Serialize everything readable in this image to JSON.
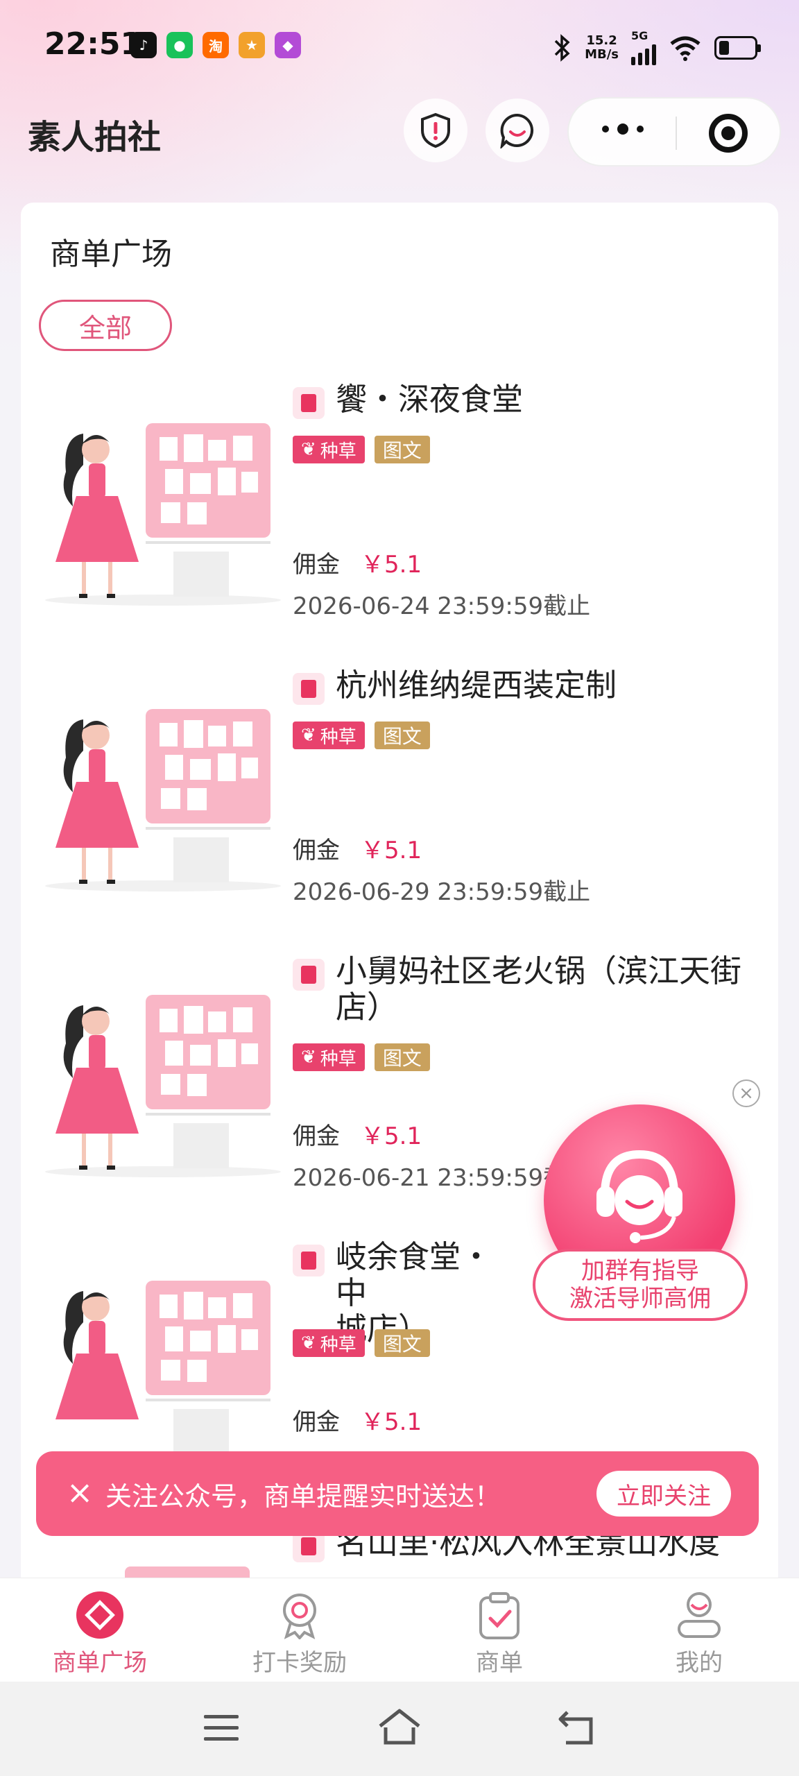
{
  "status_bar": {
    "time": "22:51",
    "speed_value": "15.2",
    "speed_unit": "MB/s",
    "network": "5G",
    "app_icons": [
      "tiktok-icon",
      "wechat-icon",
      "taobao-icon",
      "game-icon",
      "chat-app-icon"
    ]
  },
  "header": {
    "title": "素人拍社",
    "buttons": [
      "shield-alert-icon",
      "chat-bubble-icon",
      "more-dots-icon",
      "record-target-icon"
    ]
  },
  "main": {
    "section_title": "商单广场",
    "filter_chip": "全部",
    "commission_label": "佣金",
    "items": [
      {
        "title": "饗・深夜食堂",
        "tags": [
          "种草",
          "图文"
        ],
        "price": "￥5.1",
        "deadline": "2026-06-24 23:59:59截止"
      },
      {
        "title": "杭州维纳缇西装定制",
        "tags": [
          "种草",
          "图文"
        ],
        "price": "￥5.1",
        "deadline": "2026-06-29 23:59:59截止"
      },
      {
        "title": "小舅妈社区老火锅（滨江天街店）",
        "tags": [
          "种草",
          "图文"
        ],
        "price": "￥5.1",
        "deadline": "2026-06-21 23:59:59截"
      },
      {
        "title": "岐余食堂・中",
        "title2": "城店）",
        "tags": [
          "种草",
          "图文"
        ],
        "price": "￥5.1",
        "deadline": ""
      },
      {
        "title": "名山里·松风入林全景山水度",
        "tags": [],
        "price": "",
        "deadline": ""
      }
    ]
  },
  "floating_service": {
    "line1": "加群有指导",
    "line2": "激活导师高佣"
  },
  "follow_banner": {
    "text": "关注公众号，商单提醒实时送达！",
    "button": "立即关注"
  },
  "tabbar": {
    "tabs": [
      {
        "label": "商单广场",
        "active": true
      },
      {
        "label": "打卡奖励",
        "active": false
      },
      {
        "label": "商单",
        "active": false
      },
      {
        "label": "我的",
        "active": false
      }
    ]
  },
  "colors": {
    "accent": "#e8426d",
    "gold_tag": "#c9a15d",
    "price": "#e0245a"
  }
}
